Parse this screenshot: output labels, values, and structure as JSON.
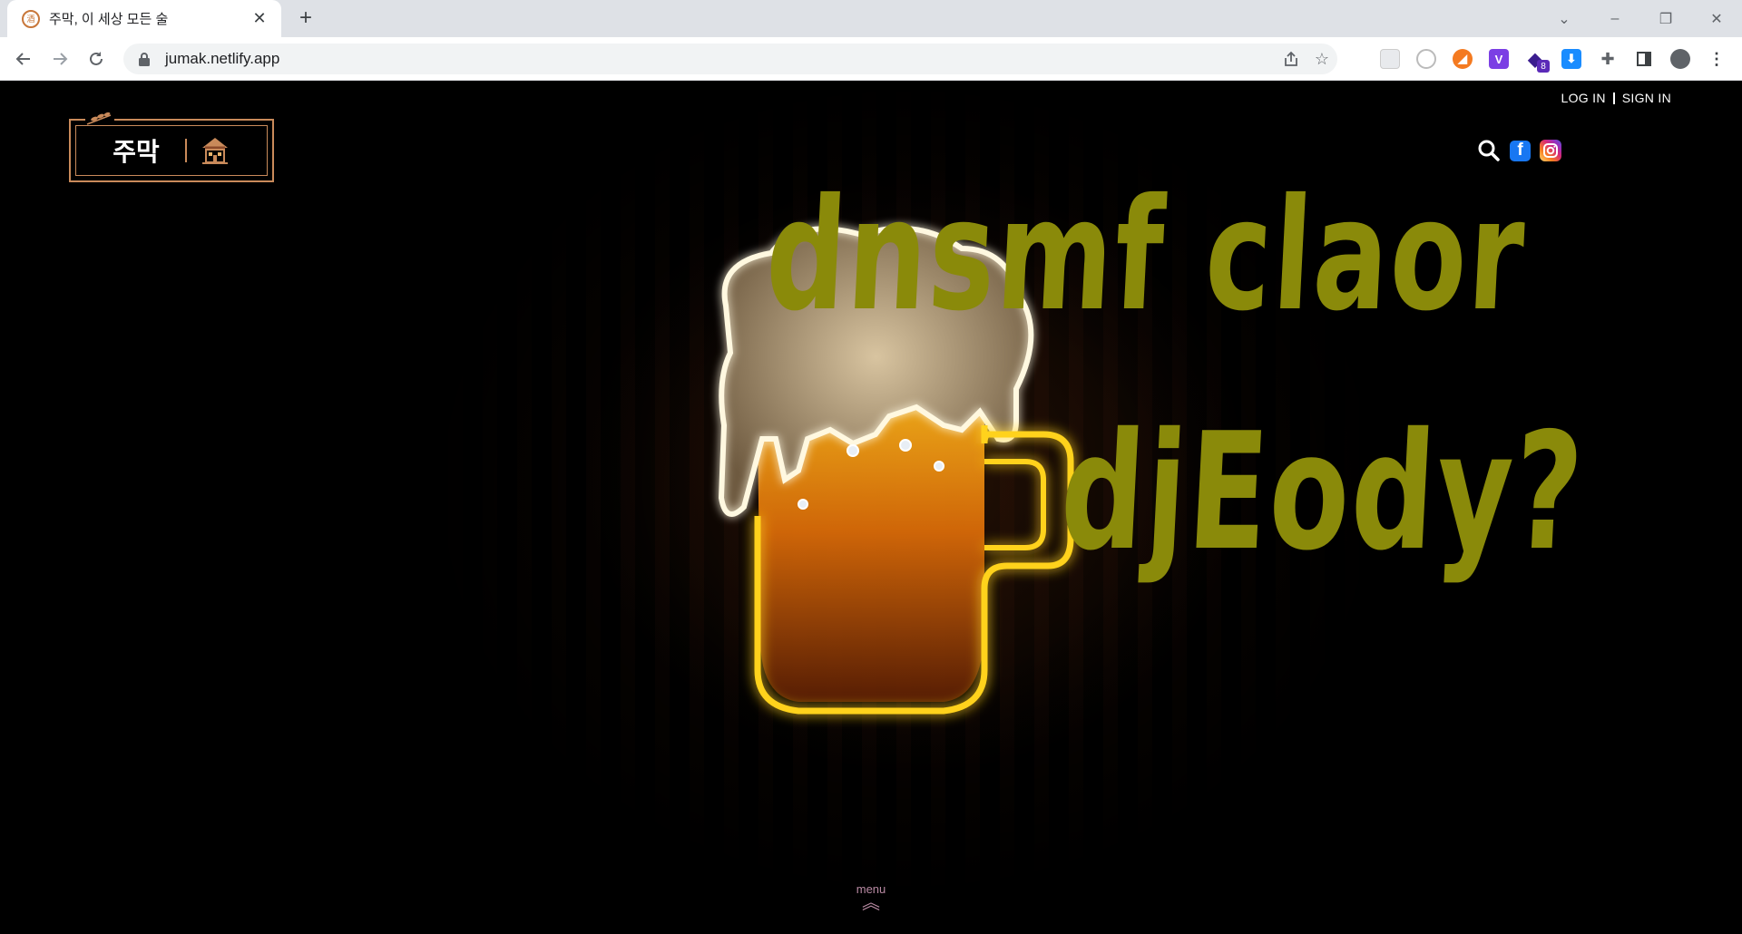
{
  "browser": {
    "tab_title": "주막, 이 세상 모든 술",
    "tab_close": "✕",
    "new_tab": "+",
    "url": "jumak.netlify.app",
    "extension_badge": "8"
  },
  "header": {
    "login_label": "LOG IN",
    "signin_label": "SIGN IN",
    "logo_text": "주막"
  },
  "hero": {
    "line1": "dnsmf claor",
    "line2": "djEody?"
  },
  "menu": {
    "label": "menu",
    "chevron": "︽"
  },
  "colors": {
    "hero_text": "#8a8a0a",
    "logo_border": "#c98a5a",
    "menu": "#b98aa3",
    "facebook": "#1877f2"
  },
  "icons": [
    "lock-icon",
    "share-icon",
    "star-icon",
    "puzzle-icon",
    "search-icon",
    "facebook-icon",
    "instagram-icon",
    "chevron-up-icon"
  ]
}
